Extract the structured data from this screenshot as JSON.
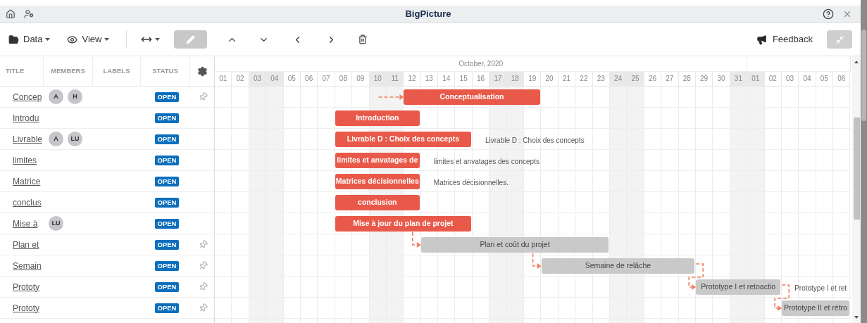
{
  "window": {
    "title": "BigPicture"
  },
  "toolbar": {
    "menus": [
      {
        "label": "Data"
      },
      {
        "label": "View"
      }
    ],
    "feedback": "Feedback"
  },
  "columns": [
    "TITLE",
    "MEMBERS",
    "LABELS",
    "STATUS"
  ],
  "months": [
    {
      "label": "October, 2020",
      "days": [
        {
          "label": "01",
          "weekend": false
        },
        {
          "label": "02",
          "weekend": false
        },
        {
          "label": "03",
          "weekend": true
        },
        {
          "label": "04",
          "weekend": true
        },
        {
          "label": "05",
          "weekend": false
        },
        {
          "label": "06",
          "weekend": false
        },
        {
          "label": "07",
          "weekend": false
        },
        {
          "label": "08",
          "weekend": false
        },
        {
          "label": "09",
          "weekend": false
        },
        {
          "label": "10",
          "weekend": true
        },
        {
          "label": "11",
          "weekend": true
        },
        {
          "label": "12",
          "weekend": false
        },
        {
          "label": "13",
          "weekend": false
        },
        {
          "label": "14",
          "weekend": false
        },
        {
          "label": "15",
          "weekend": false
        },
        {
          "label": "16",
          "weekend": false
        },
        {
          "label": "17",
          "weekend": true
        },
        {
          "label": "18",
          "weekend": true
        },
        {
          "label": "19",
          "weekend": false
        },
        {
          "label": "20",
          "weekend": false
        },
        {
          "label": "21",
          "weekend": false
        },
        {
          "label": "22",
          "weekend": false
        },
        {
          "label": "23",
          "weekend": false
        },
        {
          "label": "24",
          "weekend": true
        },
        {
          "label": "25",
          "weekend": true
        },
        {
          "label": "26",
          "weekend": false
        },
        {
          "label": "27",
          "weekend": false
        },
        {
          "label": "28",
          "weekend": false
        },
        {
          "label": "29",
          "weekend": false
        },
        {
          "label": "30",
          "weekend": false
        },
        {
          "label": "31",
          "weekend": true
        }
      ]
    },
    {
      "days": [
        {
          "label": "01",
          "weekend": true
        },
        {
          "label": "02",
          "weekend": false
        },
        {
          "label": "03",
          "weekend": false
        },
        {
          "label": "04",
          "weekend": false
        },
        {
          "label": "05",
          "weekend": false
        },
        {
          "label": "06",
          "weekend": false
        }
      ]
    }
  ],
  "tasks": [
    {
      "title": "Concep",
      "members": [
        "A",
        "H"
      ],
      "status": "OPEN",
      "pinned": true,
      "linked": true,
      "bar": {
        "label": "Conceptualisation",
        "color": "#e8594a"
      }
    },
    {
      "title": "Introdu",
      "status": "OPEN",
      "pinned": false,
      "linked": false,
      "bar": {
        "label": "Introduction",
        "color": "#e8594a"
      }
    },
    {
      "title": "Livrable",
      "members": [
        "A",
        "LU"
      ],
      "status": "OPEN",
      "pinned": false,
      "linked": false,
      "bar": {
        "label": "Livrable D : Choix des concepts",
        "color": "#e8594a"
      },
      "note": "Livrable D : Choix des concepts"
    },
    {
      "title": "limites",
      "status": "OPEN",
      "pinned": false,
      "linked": false,
      "bar": {
        "label": "limites et anvatages de",
        "color": "#e8594a"
      },
      "note": "limites et anvatages des concepts"
    },
    {
      "title": "Matrice",
      "status": "OPEN",
      "pinned": false,
      "linked": false,
      "bar": {
        "label": "Matrices décisionnelles",
        "color": "#e8594a"
      },
      "note": "Matrices décisionnelles."
    },
    {
      "title": "conclus",
      "status": "OPEN",
      "pinned": false,
      "linked": false,
      "bar": {
        "label": "conclusion",
        "color": "#e8594a"
      }
    },
    {
      "title": "Mise à",
      "members": [
        "LU"
      ],
      "status": "OPEN",
      "pinned": false,
      "linked": false,
      "bar": {
        "label": "Mise à jour du plan de projet",
        "color": "#e8594a"
      }
    },
    {
      "title": "Plan et",
      "status": "OPEN",
      "pinned": true,
      "linked": true,
      "bar": {
        "label": "Plan et coût du projet",
        "color": "#c9c9c9"
      }
    },
    {
      "title": "Semain",
      "status": "OPEN",
      "pinned": true,
      "linked": true,
      "bar": {
        "label": "Semaine de relâche",
        "color": "#c9c9c9"
      }
    },
    {
      "title": "Prototy",
      "status": "OPEN",
      "pinned": true,
      "linked": true,
      "bar": {
        "label": "Prototype I et retoactio",
        "color": "#c9c9c9"
      },
      "note": "Prototype I et ret"
    },
    {
      "title": "Prototy",
      "status": "OPEN",
      "pinned": true,
      "linked": true,
      "bar": {
        "label": "Prototype II et rétro",
        "color": "#c9c9c9"
      }
    }
  ]
}
